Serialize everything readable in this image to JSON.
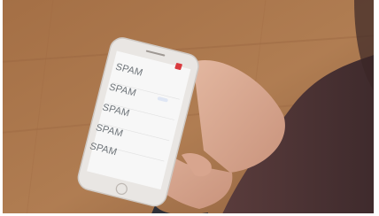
{
  "scene": {
    "description_text": "",
    "screen_rows": [
      {
        "word": "SPAM"
      },
      {
        "word": "SPAM"
      },
      {
        "word": "SPAM"
      },
      {
        "word": "SPAM"
      },
      {
        "word": "SPAM"
      }
    ]
  }
}
